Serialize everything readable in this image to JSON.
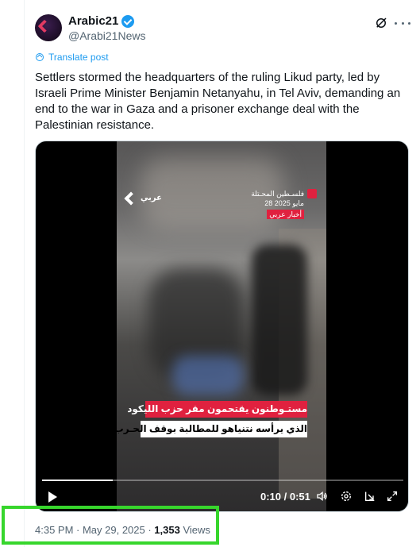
{
  "post": {
    "author": {
      "display_name": "Arabic21",
      "handle": "@Arabi21News",
      "verified_icon": "verified-badge-icon",
      "avatar_icon": "arabic21-logo-icon"
    },
    "translate_label": "Translate post",
    "text": "Settlers stormed the headquarters of the ruling Likud party, led by Israeli Prime Minister Benjamin Netanyahu, in Tel Aviv, demanding an end to the war in Gaza and a prisoner exchange deal with the Palestinian resistance.",
    "timestamp": "4:35 PM · May 29, 2025 · ",
    "views_count": "1,353",
    "views_label": " Views"
  },
  "video": {
    "logo_text": "عربي",
    "location_line1": "فلسـطين المحـتلة",
    "location_line2": "28 مايو 2025",
    "location_tag": "أخبار عربي",
    "caption_line1": "مستـوطنون يقتحمون مقر حزب الليكود",
    "caption_line2": "الذي يرأسه نتنياهو للمطالبة بوقف الحـرب",
    "time": "0:10 / 0:51",
    "progress_fraction": 0.196
  },
  "colors": {
    "accent": "#1d9bf0",
    "highlight": "#37d62c",
    "overlay_red": "#e0213f",
    "secondary_text": "#536471"
  }
}
